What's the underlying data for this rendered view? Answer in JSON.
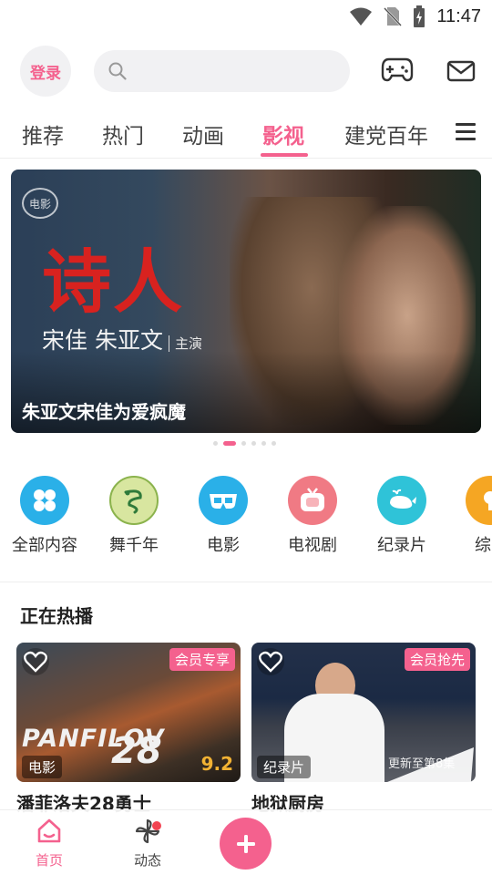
{
  "status": {
    "time": "11:47"
  },
  "header": {
    "login_label": "登录",
    "search_placeholder": ""
  },
  "tabs": [
    {
      "label": "推荐"
    },
    {
      "label": "热门"
    },
    {
      "label": "动画"
    },
    {
      "label": "影视",
      "active": true
    },
    {
      "label": "建党百年"
    }
  ],
  "banner": {
    "logo_text": "电影",
    "title": "诗人",
    "cast": "宋佳 朱亚文",
    "cast_role": "主演",
    "caption": "朱亚文宋佳为爱疯魔",
    "dots": 6,
    "active_dot": 1
  },
  "categories": [
    {
      "label": "全部内容",
      "icon": "grid-icon",
      "color": "#2ab0e8"
    },
    {
      "label": "舞千年",
      "icon": "dragon-icon",
      "color": "#d8e6a0"
    },
    {
      "label": "电影",
      "icon": "3d-glasses-icon",
      "color": "#2ab0e8"
    },
    {
      "label": "电视剧",
      "icon": "tv-icon",
      "color": "#f07a84"
    },
    {
      "label": "纪录片",
      "icon": "whale-icon",
      "color": "#2fc3d8"
    },
    {
      "label": "综",
      "icon": "variety-icon",
      "color": "#f5a623"
    }
  ],
  "section": {
    "title": "正在热播"
  },
  "items": [
    {
      "vip": "会员专享",
      "genre": "电影",
      "score": "9.2",
      "poster_text": "PANFILOV",
      "poster_num": "28",
      "title": "潘菲洛夫28勇士"
    },
    {
      "vip": "会员抢先",
      "genre": "纪录片",
      "watermark": "更新至第8集",
      "title": "地狱厨房"
    }
  ],
  "nav": {
    "home": "首页",
    "feed": "动态"
  },
  "colors": {
    "accent": "#f4618e"
  }
}
